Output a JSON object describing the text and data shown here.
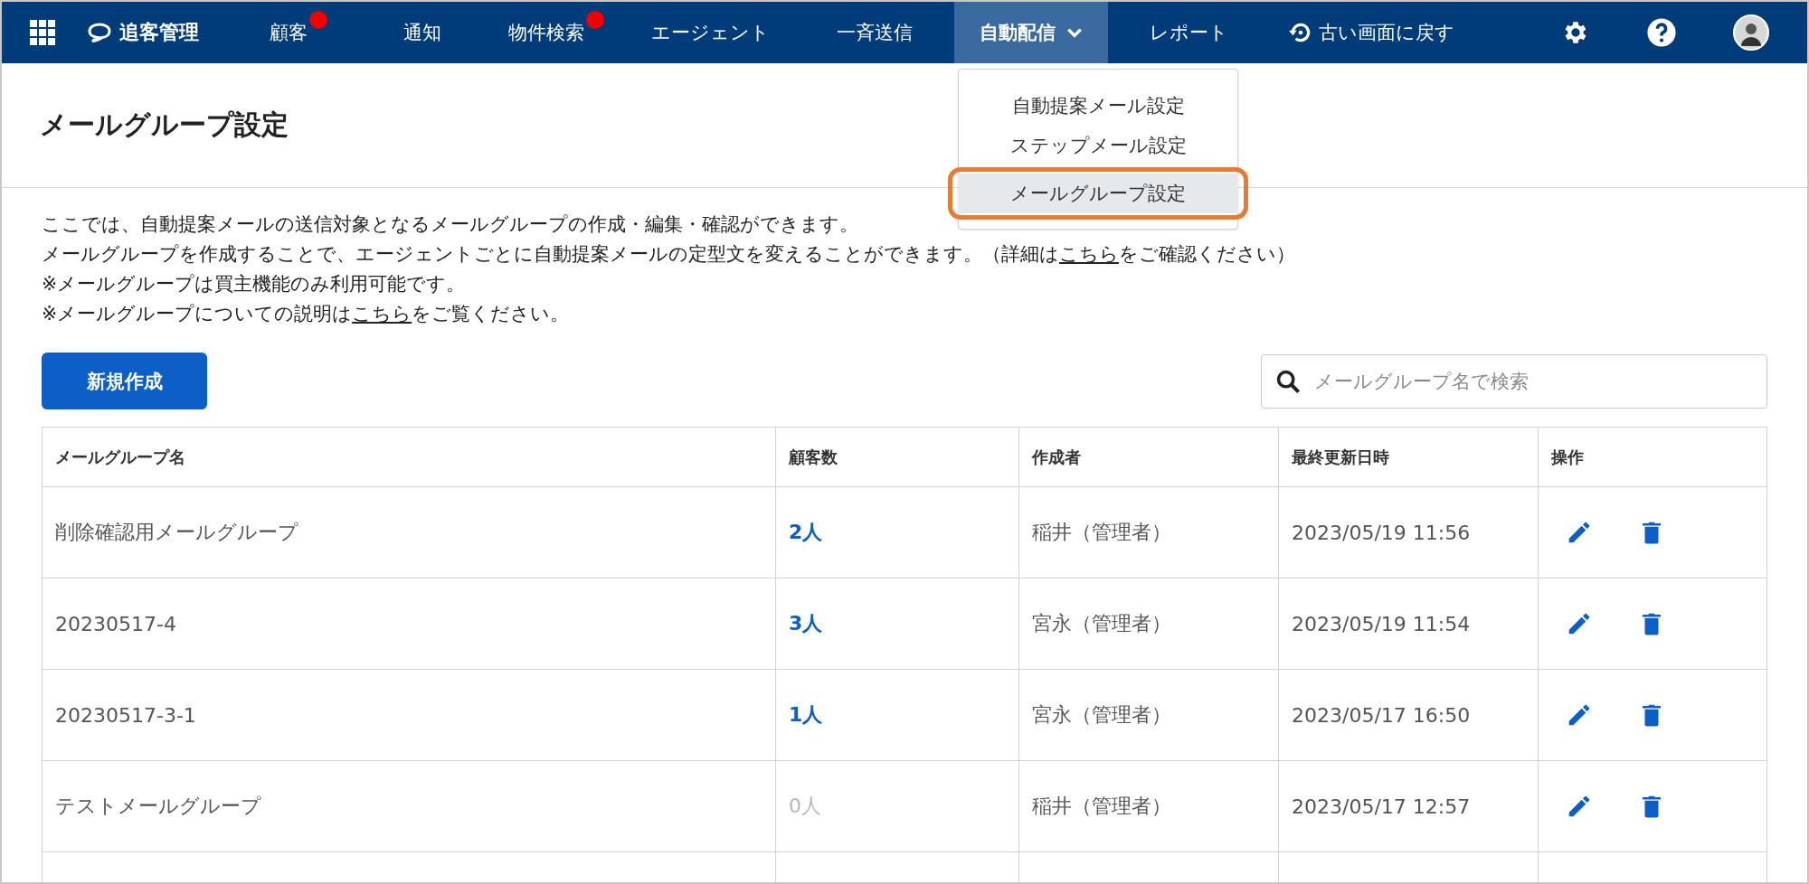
{
  "nav": {
    "brand": "追客管理",
    "items": [
      {
        "label": "顧客",
        "selected": false,
        "badge": true,
        "dropdown": false
      },
      {
        "label": "通知",
        "selected": false,
        "badge": false,
        "dropdown": false
      },
      {
        "label": "物件検索",
        "selected": false,
        "badge": true,
        "dropdown": false
      },
      {
        "label": "エージェント",
        "selected": false,
        "badge": false,
        "dropdown": false
      },
      {
        "label": "一斉送信",
        "selected": false,
        "badge": false,
        "dropdown": false
      },
      {
        "label": "自動配信",
        "selected": true,
        "badge": false,
        "dropdown": true
      },
      {
        "label": "レポート",
        "selected": false,
        "badge": false,
        "dropdown": false
      }
    ],
    "back_link": "古い画面に戻す"
  },
  "menu": {
    "items": [
      {
        "label": "自動提案メール設定",
        "selected": false,
        "highlighted": false
      },
      {
        "label": "ステップメール設定",
        "selected": false,
        "highlighted": false
      },
      {
        "label": "メールグループ設定",
        "selected": true,
        "highlighted": true
      }
    ]
  },
  "page_title": "メールグループ設定",
  "description": [
    [
      {
        "kind": "text",
        "text": "ここでは、自動提案メールの送信対象となるメールグループの作成・編集・確認ができます。"
      }
    ],
    [
      {
        "kind": "text",
        "text": "メールグループを作成することで、エージェントごとに自動提案メールの定型文を変えることができます。（詳細は"
      },
      {
        "kind": "link",
        "text": "こちら"
      },
      {
        "kind": "text",
        "text": "をご確認ください）"
      }
    ],
    [
      {
        "kind": "text",
        "text": "※メールグループは買主機能のみ利用可能です。"
      }
    ],
    [
      {
        "kind": "text",
        "text": "※メールグループについての説明は"
      },
      {
        "kind": "link",
        "text": "こちら"
      },
      {
        "kind": "text",
        "text": "をご覧ください。"
      }
    ]
  ],
  "create_button": "新規作成",
  "search": {
    "placeholder": "メールグループ名で検索"
  },
  "table": {
    "columns": [
      "メールグループ名",
      "顧客数",
      "作成者",
      "最終更新日時",
      "操作"
    ],
    "rows": [
      {
        "name": "削除確認用メールグループ",
        "count": "2人",
        "disabled": false,
        "creator": "稲井（管理者）",
        "updated": "2023/05/19 11:56"
      },
      {
        "name": "20230517-4",
        "count": "3人",
        "disabled": false,
        "creator": "宮永（管理者）",
        "updated": "2023/05/19 11:54"
      },
      {
        "name": "20230517-3-1",
        "count": "1人",
        "disabled": false,
        "creator": "宮永（管理者）",
        "updated": "2023/05/17 16:50"
      },
      {
        "name": "テストメールグループ",
        "count": "0人",
        "disabled": true,
        "creator": "稲井（管理者）",
        "updated": "2023/05/17 12:57"
      }
    ]
  }
}
